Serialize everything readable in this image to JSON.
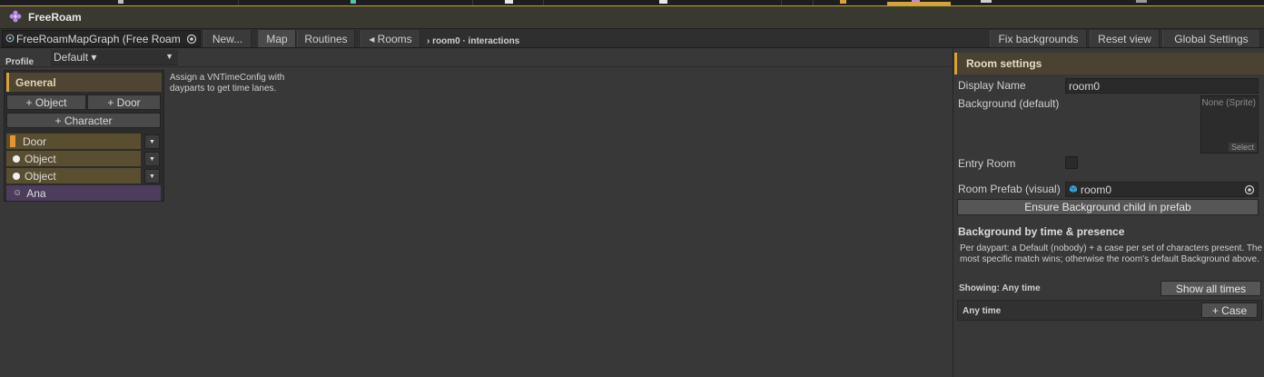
{
  "window": {
    "title": "FreeRoam",
    "icon": "flower-icon"
  },
  "toolbar": {
    "graph_field": "FreeRoamMapGraph (Free Roam",
    "new_label": "New...",
    "map_tab": "Map",
    "routines_tab": "Routines",
    "rooms_label": "◂ Rooms",
    "breadcrumb": "› room0 · interactions",
    "fix_backgrounds": "Fix backgrounds",
    "reset_view": "Reset view",
    "global_settings": "Global Settings"
  },
  "profile": {
    "label": "Profile",
    "value": "Default ▾"
  },
  "left_panel": {
    "section": "General",
    "add_object": "+ Object",
    "add_door": "+ Door",
    "add_character": "+ Character",
    "nodes": [
      {
        "label": "Door",
        "kind": "door"
      },
      {
        "label": "Object",
        "kind": "object"
      },
      {
        "label": "Object",
        "kind": "object"
      },
      {
        "label": "Ana",
        "kind": "character"
      }
    ]
  },
  "hint": "Assign a VNTimeConfig with dayparts to get time lanes.",
  "inspector": {
    "title": "Room settings",
    "display_name_label": "Display Name",
    "display_name_value": "room0",
    "background_label": "Background (default)",
    "background_none": "None (Sprite)",
    "background_select": "Select",
    "entry_room_label": "Entry Room",
    "entry_room_checked": false,
    "prefab_label": "Room Prefab (visual)",
    "prefab_value": "room0",
    "ensure_button": "Ensure Background child in prefab",
    "section_title": "Background by time & presence",
    "description": "Per daypart: a Default (nobody) + a case per set of characters present. The most specific match wins; otherwise the room's default Background above.",
    "showing": "Showing: Any time",
    "show_all_button": "Show all times",
    "time_row_label": "Any time",
    "case_button": "+ Case"
  },
  "colors": {
    "accent": "#d6a23a",
    "node_yellow": "#5a4e31",
    "node_purple": "#4c3d5d",
    "door_swatch": "#e5952f"
  }
}
